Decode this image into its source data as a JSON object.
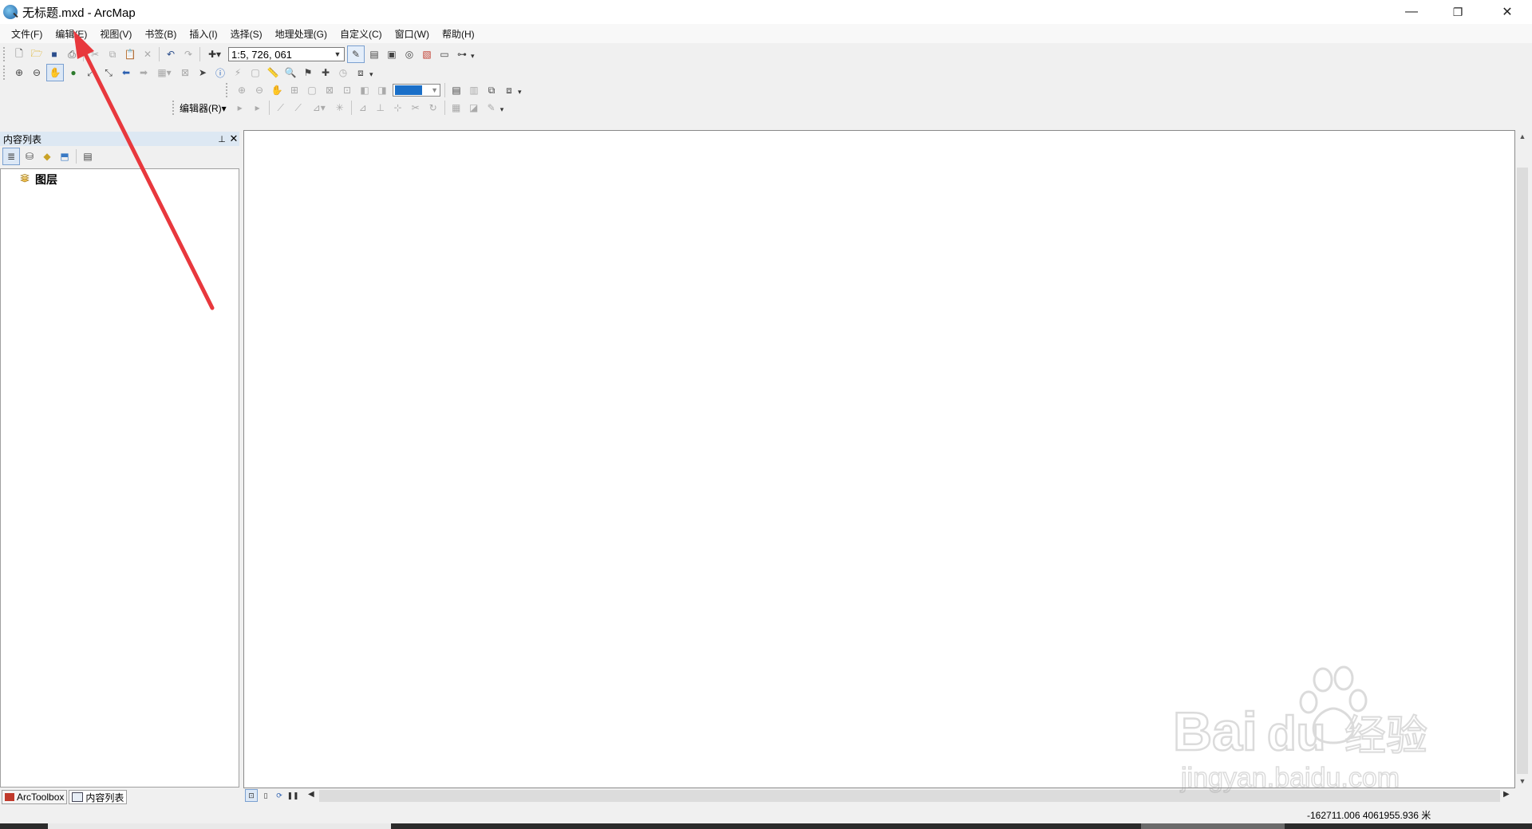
{
  "window": {
    "title": "无标题.mxd - ArcMap",
    "minimize": "—",
    "restore": "❐",
    "close": "✕"
  },
  "menu": [
    "文件(F)",
    "编辑(E)",
    "视图(V)",
    "书签(B)",
    "插入(I)",
    "选择(S)",
    "地理处理(G)",
    "自定义(C)",
    "窗口(W)",
    "帮助(H)"
  ],
  "toolbar": {
    "scale": "1:5, 726, 061",
    "editor_label": "编辑器(R)▾"
  },
  "toc": {
    "title": "内容列表",
    "pin": "📌",
    "close": "✕",
    "layers_root": "图层"
  },
  "bottom_tabs": {
    "arctoolbox": "ArcToolbox",
    "toc": "内容列表"
  },
  "status": {
    "coordinates": "-162711.006  4061955.936 米"
  },
  "watermark": {
    "brand": "Bai",
    "brand2": "du",
    "cn": "经验",
    "url": "jingyan.baidu.com"
  },
  "colors": {
    "accent_arrow": "#e8383d",
    "toc_header": "#dde8f3",
    "fill_swatch": "#1a6fc8"
  }
}
